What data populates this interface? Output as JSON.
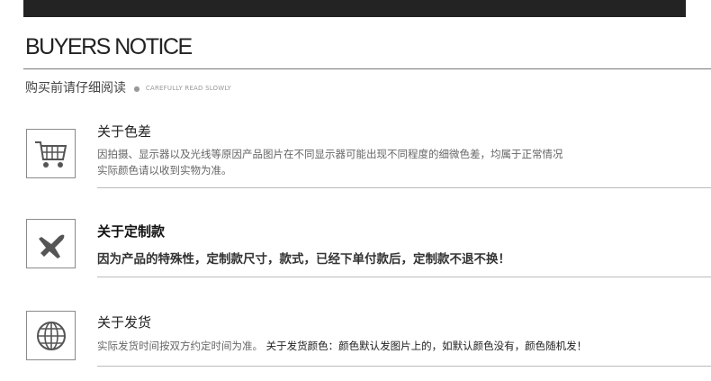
{
  "header": {
    "title": "BUYERS NOTICE",
    "subtitle_cn": "购买前请仔细阅读",
    "subtitle_dot": "●",
    "subtitle_en": "CAREFULLY READ SLOWLY"
  },
  "sections": [
    {
      "icon": "shopping-cart-icon",
      "heading": "关于色差",
      "text_line1": "因拍摄、显示器以及光线等原因产品图片在不同显示器可能出现不同程度的细微色差，均属于正常情况",
      "text_line2": "实际颜色请以收到实物为准。"
    },
    {
      "icon": "airplane-icon",
      "heading": "关于定制款",
      "text_line1": "因为产品的特殊性，定制款尺寸，款式，已经下单付款后，定制款不退不换！"
    },
    {
      "icon": "globe-icon",
      "heading": "关于发货",
      "text_part1": "实际发货时间按双方约定时间为准。",
      "text_part2": "关于发货颜色：颜色默认发图片上的，如默认颜色没有，颜色随机发！"
    }
  ]
}
